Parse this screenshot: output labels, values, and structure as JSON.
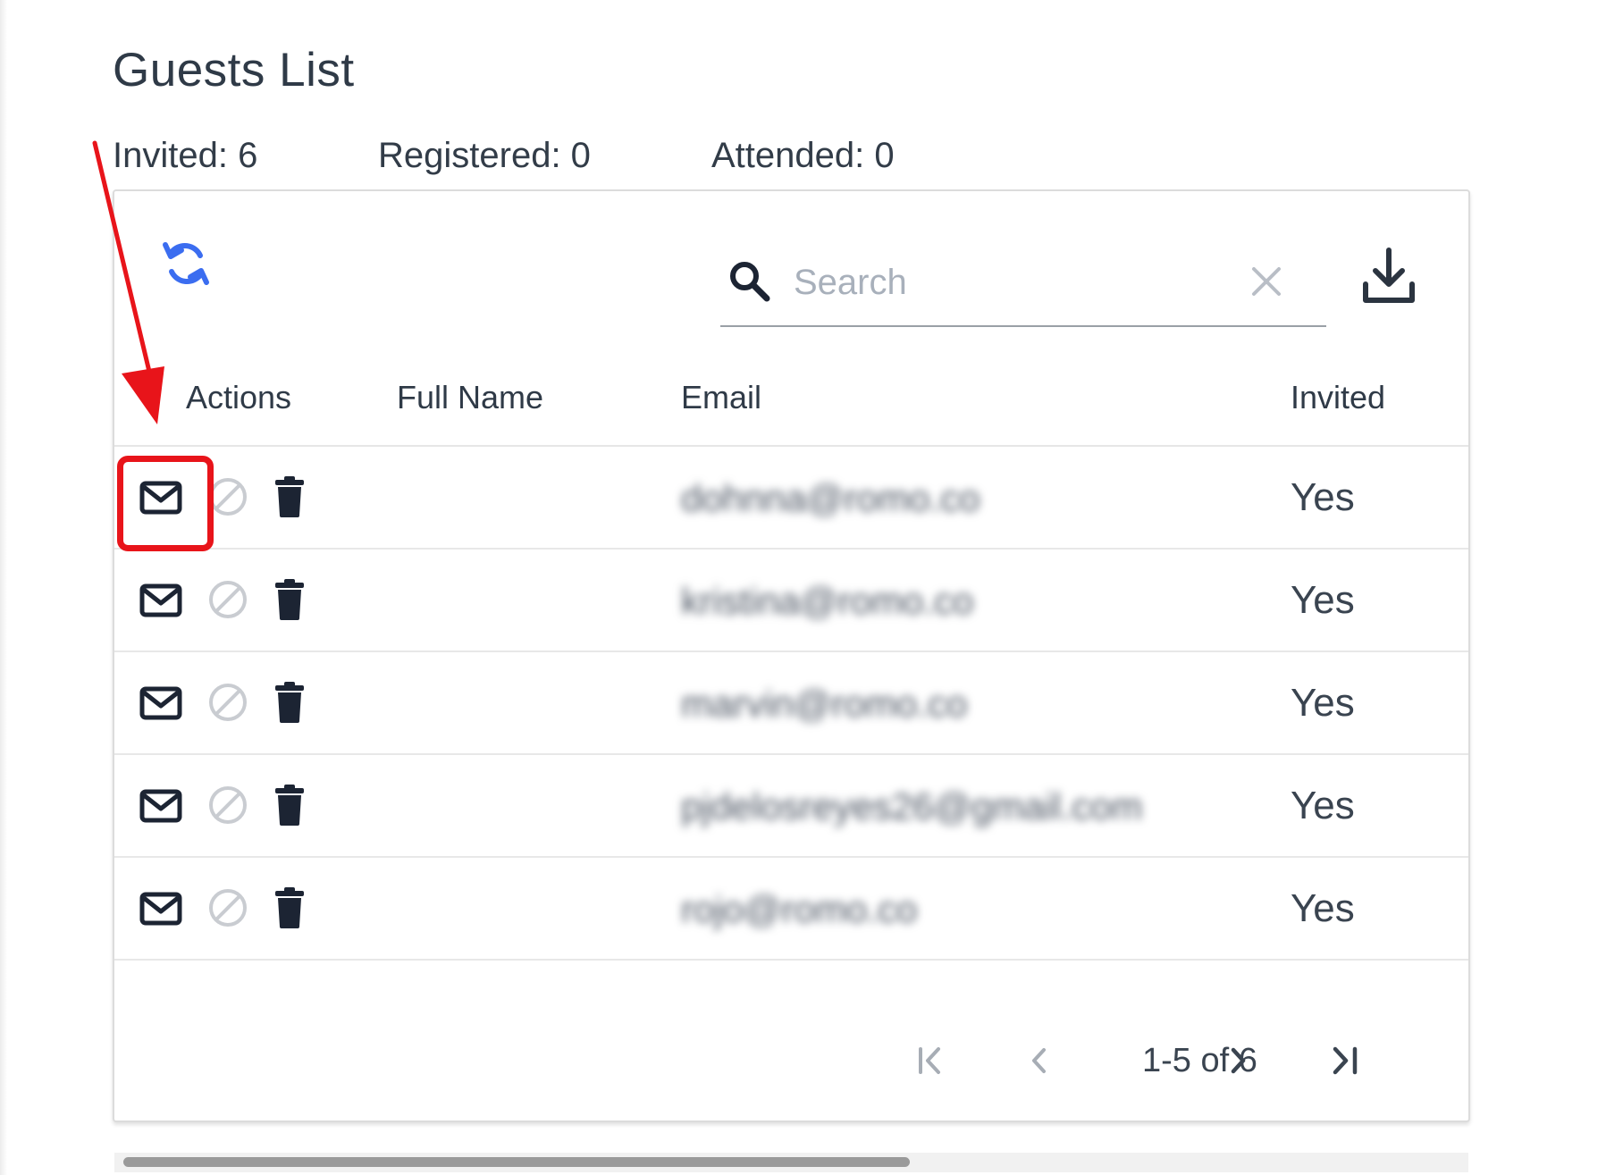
{
  "page": {
    "title": "Guests List"
  },
  "stats": {
    "invited": "Invited: 6",
    "registered": "Registered: 0",
    "attended": "Attended: 0"
  },
  "toolbar": {
    "search_placeholder": "Search",
    "refresh_icon": "refresh-icon",
    "download_icon": "download-icon",
    "clear_icon": "close-icon"
  },
  "table": {
    "columns": [
      "Actions",
      "Full Name",
      "Email",
      "Invited"
    ],
    "rows": [
      {
        "full_name": "",
        "email": "dohnna@romo.co",
        "invited": "Yes"
      },
      {
        "full_name": "",
        "email": "kristina@romo.co",
        "invited": "Yes"
      },
      {
        "full_name": "",
        "email": "marvin@romo.co",
        "invited": "Yes"
      },
      {
        "full_name": "",
        "email": "pjdelosreyes26@gmail.com",
        "invited": "Yes"
      },
      {
        "full_name": "",
        "email": "rojo@romo.co",
        "invited": "Yes"
      }
    ],
    "action_icons": [
      "mail-icon",
      "block-icon",
      "trash-icon"
    ]
  },
  "pagination": {
    "range": "1-5 of 6"
  },
  "colors": {
    "annotation": "#e8141a",
    "refresh": "#3b6df0",
    "icon_dark": "#1c2433",
    "icon_muted": "#c9ccd1"
  }
}
